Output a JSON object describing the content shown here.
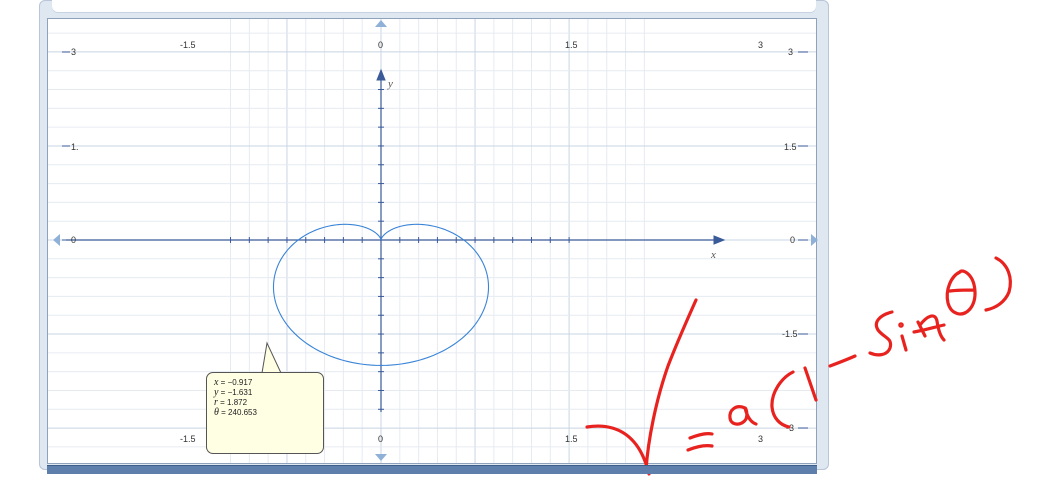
{
  "window": {
    "accent": "#5e7fab",
    "grid_color": "#dbe2ec",
    "axis_color": "#3a5a99"
  },
  "graph": {
    "x_labels_top": [
      "-1.5",
      "0",
      "1.5",
      "3"
    ],
    "x_labels_bottom": [
      "-1.5",
      "0",
      "1.5",
      "3"
    ],
    "y_labels_left": [
      "3",
      "1.",
      "0",
      "",
      ""
    ],
    "y_labels_right": [
      "3",
      "1.5",
      "0",
      "-1.5",
      "-3"
    ],
    "x_axis_label": "x",
    "y_axis_label": "y",
    "curve_color": "#3a84d8",
    "xlim": [
      -2.5,
      3.4
    ],
    "ylim": [
      -3.05,
      3.05
    ]
  },
  "tooltip": {
    "x_var": "x",
    "x_val": " = −0.917",
    "y_var": "y",
    "y_val": " = −1.631",
    "r_var": "r",
    "r_val": " = 1.872",
    "theta_var": "θ",
    "theta_val": " = 240.653"
  },
  "annotation": {
    "handwriting": "r=a(1-sinθ)",
    "color": "#e8231f"
  }
}
